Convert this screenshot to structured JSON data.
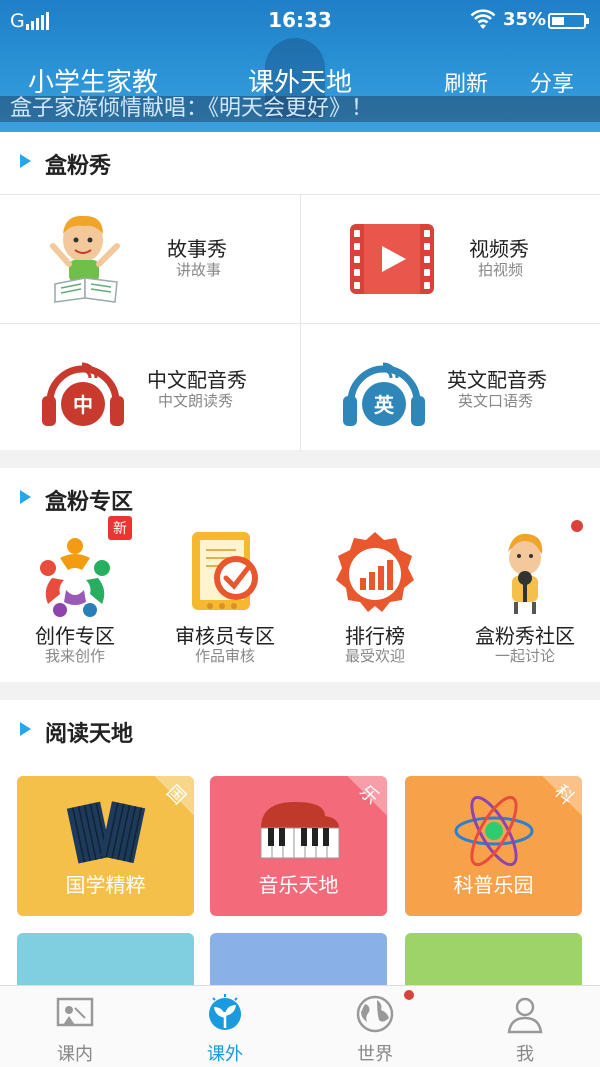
{
  "status": {
    "carrier": "G",
    "time": "16:33",
    "battery": "35%"
  },
  "header": {
    "title_left": "小学生家教",
    "title_center": "课外天地",
    "refresh_label": "刷新",
    "share_label": "分享",
    "ticker": "盒子家族倾情献唱：《明天会更好》！"
  },
  "show": {
    "title": "盒粉秀",
    "items": [
      {
        "label": "故事秀",
        "sub": "讲故事"
      },
      {
        "label": "视频秀",
        "sub": "拍视频"
      },
      {
        "label": "中文配音秀",
        "sub": "中文朗读秀",
        "icon_text": "中"
      },
      {
        "label": "英文配音秀",
        "sub": "英文口语秀",
        "icon_text": "英"
      }
    ]
  },
  "zone": {
    "title": "盒粉专区",
    "new_badge": "新",
    "items": [
      {
        "label": "创作专区",
        "sub": "我来创作"
      },
      {
        "label": "审核员专区",
        "sub": "作品审核"
      },
      {
        "label": "排行榜",
        "sub": "最受欢迎"
      },
      {
        "label": "盒粉秀社区",
        "sub": "一起讨论"
      }
    ]
  },
  "reading": {
    "title": "阅读天地",
    "cards": [
      {
        "label": "国学精粹",
        "tag": "国",
        "color": "#f5c04a"
      },
      {
        "label": "音乐天地",
        "tag": "乐",
        "color": "#f36b7a"
      },
      {
        "label": "科普乐园",
        "tag": "科",
        "color": "#f7a24b"
      }
    ],
    "lower_card_colors": [
      "#7fcfe0",
      "#8ab0e8",
      "#9ed36a"
    ]
  },
  "tabs": [
    {
      "label": "课内"
    },
    {
      "label": "课外"
    },
    {
      "label": "世界"
    },
    {
      "label": "我"
    }
  ]
}
